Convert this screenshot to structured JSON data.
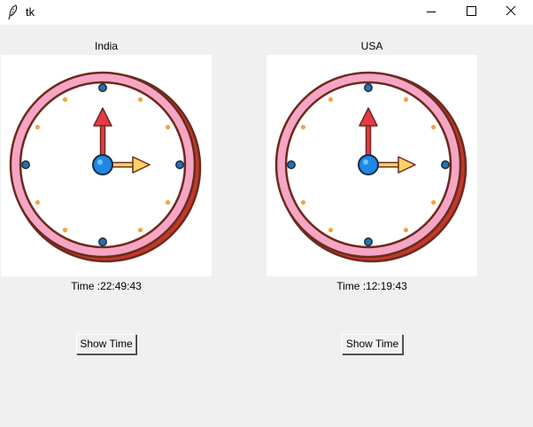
{
  "window": {
    "title": "tk",
    "icons": {
      "app": "feather-icon",
      "minimize": "minimize-icon",
      "maximize": "maximize-icon",
      "close": "close-icon"
    }
  },
  "clocks": [
    {
      "region": "India",
      "time_label": "Time :22:49:43",
      "button_label": "Show Time",
      "face_icon": "clock-face-icon"
    },
    {
      "region": "USA",
      "time_label": "Time :12:19:43",
      "button_label": "Show Time",
      "face_icon": "clock-face-icon"
    }
  ],
  "colors": {
    "window_bg": "#f0f0f0",
    "clock_ring": "#f4a6c4",
    "clock_outline": "#6b2a1e",
    "hour_hand": "#e63946",
    "minute_hand": "#ffd166",
    "center_dot": "#1e88e5",
    "hour_marker": "#2a6fb0",
    "minute_marker": "#f4a340"
  }
}
